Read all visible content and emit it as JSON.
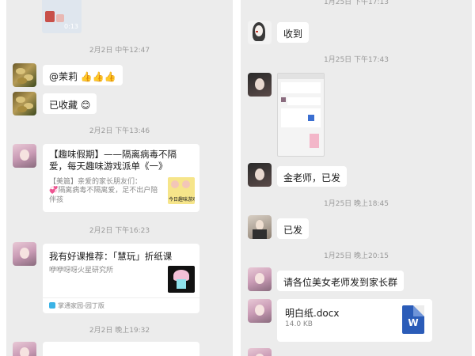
{
  "left_chat": {
    "timestamps": [
      "2月2日 中午12:47",
      "2月2日 下午13:46",
      "2月2日 下午16:23",
      "2月2日 晚上19:32"
    ],
    "msg_mention": "@茉莉",
    "msg_saved": "已收藏",
    "card1": {
      "title": "【趣味假期】——隔离病毒不隔爱，每天趣味游戏派单《一》",
      "desc_line1": "【美篇】亲爱的家长朋友们：",
      "desc_line2": "💞隔离病毒不隔离爱，足不出户陪伴孩",
      "thumb_text": "今日趣味游戏"
    },
    "card2": {
      "title": "我有好课推荐：「慧玩」折纸课",
      "subtitle": "咿咿呀呀火星研究所",
      "source": "掌通家园-园丁版"
    },
    "top_thumb_text": "0:13"
  },
  "right_chat": {
    "timestamp_top": "1月25日 下午17:13",
    "timestamps": [
      "1月25日 下午17:43",
      "1月25日 晚上18:45",
      "1月25日 晚上20:15"
    ],
    "msg_received": "收到",
    "msg_teacher": "金老师，已发",
    "msg_sent": "已发",
    "msg_request": "请各位美女老师发到家长群",
    "file": {
      "name": "明白纸.docx",
      "size": "14.0 KB",
      "icon_letter": "W"
    }
  },
  "colors": {
    "bg": "#ececec",
    "bubble": "#ffffff",
    "word_blue": "#2b5cb8"
  }
}
